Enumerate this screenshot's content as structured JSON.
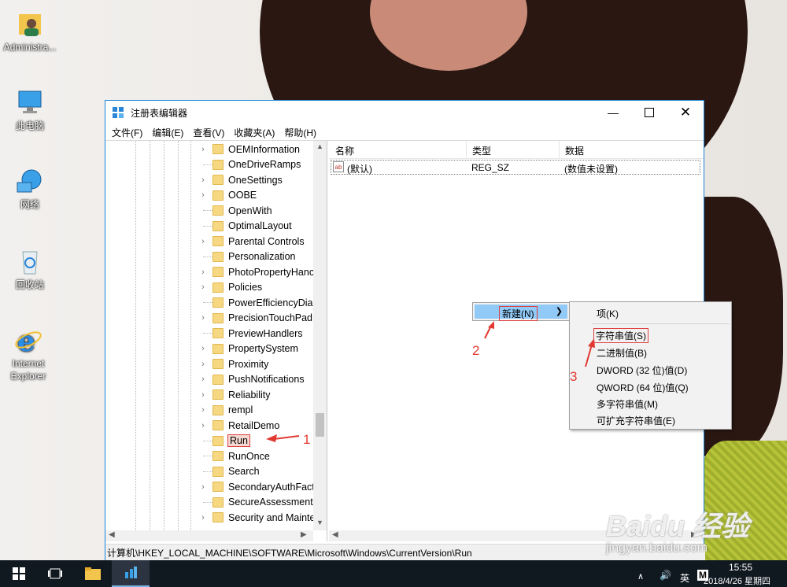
{
  "desktop": {
    "icons": [
      {
        "label": "Administra..."
      },
      {
        "label": "此电脑"
      },
      {
        "label": "网络"
      },
      {
        "label": "回收站"
      },
      {
        "label": "Internet Explorer"
      }
    ]
  },
  "window": {
    "title": "注册表编辑器",
    "menus": [
      "文件(F)",
      "编辑(E)",
      "查看(V)",
      "收藏夹(A)",
      "帮助(H)"
    ],
    "tree_items": [
      {
        "name": "OEMInformation",
        "expandable": true
      },
      {
        "name": "OneDriveRamps",
        "expandable": false
      },
      {
        "name": "OneSettings",
        "expandable": true
      },
      {
        "name": "OOBE",
        "expandable": true
      },
      {
        "name": "OpenWith",
        "expandable": false
      },
      {
        "name": "OptimalLayout",
        "expandable": false
      },
      {
        "name": "Parental Controls",
        "expandable": true
      },
      {
        "name": "Personalization",
        "expandable": false
      },
      {
        "name": "PhotoPropertyHanc",
        "expandable": true
      },
      {
        "name": "Policies",
        "expandable": true
      },
      {
        "name": "PowerEfficiencyDiag",
        "expandable": false
      },
      {
        "name": "PrecisionTouchPad",
        "expandable": true
      },
      {
        "name": "PreviewHandlers",
        "expandable": false
      },
      {
        "name": "PropertySystem",
        "expandable": true
      },
      {
        "name": "Proximity",
        "expandable": true
      },
      {
        "name": "PushNotifications",
        "expandable": true
      },
      {
        "name": "Reliability",
        "expandable": true
      },
      {
        "name": "rempl",
        "expandable": true
      },
      {
        "name": "RetailDemo",
        "expandable": true
      },
      {
        "name": "Run",
        "expandable": false,
        "selected": true
      },
      {
        "name": "RunOnce",
        "expandable": false
      },
      {
        "name": "Search",
        "expandable": false
      },
      {
        "name": "SecondaryAuthFact",
        "expandable": true
      },
      {
        "name": "SecureAssessment",
        "expandable": false
      },
      {
        "name": "Security and Mainte",
        "expandable": true
      }
    ],
    "columns": [
      "名称",
      "类型",
      "数据"
    ],
    "values": [
      {
        "name": "(默认)",
        "type": "REG_SZ",
        "data": "(数值未设置)",
        "icon": "ab"
      }
    ],
    "status_path": "计算机\\HKEY_LOCAL_MACHINE\\SOFTWARE\\Microsoft\\Windows\\CurrentVersion\\Run"
  },
  "context_menu": {
    "new_label": "新建(N)",
    "submenu": [
      "项(K)",
      "字符串值(S)",
      "二进制值(B)",
      "DWORD (32 位)值(D)",
      "QWORD (64 位)值(Q)",
      "多字符串值(M)",
      "可扩充字符串值(E)"
    ]
  },
  "annotations": [
    "1",
    "2",
    "3"
  ],
  "taskbar": {
    "time": "15:55",
    "date": "2018/4/26 星期四",
    "ime": "英",
    "ime2": "M"
  },
  "watermark": {
    "brand": "Baidu 经验",
    "url": "jingyan.baidu.com"
  },
  "colors": {
    "accent": "#1883d7",
    "highlight": "#91c9f7",
    "annotation": "#e13a32",
    "taskbar": "#101820"
  }
}
